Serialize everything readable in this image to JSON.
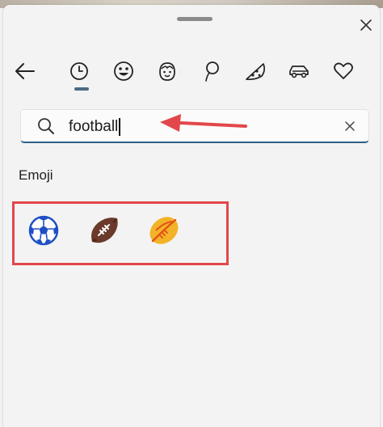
{
  "window": {
    "close_icon": "close-icon"
  },
  "toolbar": {
    "items": [
      {
        "icon": "back-arrow-icon"
      },
      {
        "icon": "recent-clock-icon",
        "selected": true
      },
      {
        "icon": "smiley-emoji-icon"
      },
      {
        "icon": "kaomoji-face-icon"
      },
      {
        "icon": "gif-balloon-icon"
      },
      {
        "icon": "pizza-food-icon"
      },
      {
        "icon": "car-travel-icon"
      },
      {
        "icon": "heart-symbols-icon"
      }
    ],
    "accent_color": "#4b6b85"
  },
  "search": {
    "value": "football",
    "icon": "search-icon",
    "clear_icon": "clear-icon",
    "underline_color": "#2d5f86"
  },
  "annotation": {
    "arrow_color": "#e2474b",
    "box_color": "#e2474b"
  },
  "results": {
    "section_label": "Emoji",
    "items": [
      {
        "name": "soccer-ball-emoji"
      },
      {
        "name": "american-football-emoji"
      },
      {
        "name": "rugby-football-emoji"
      }
    ]
  }
}
